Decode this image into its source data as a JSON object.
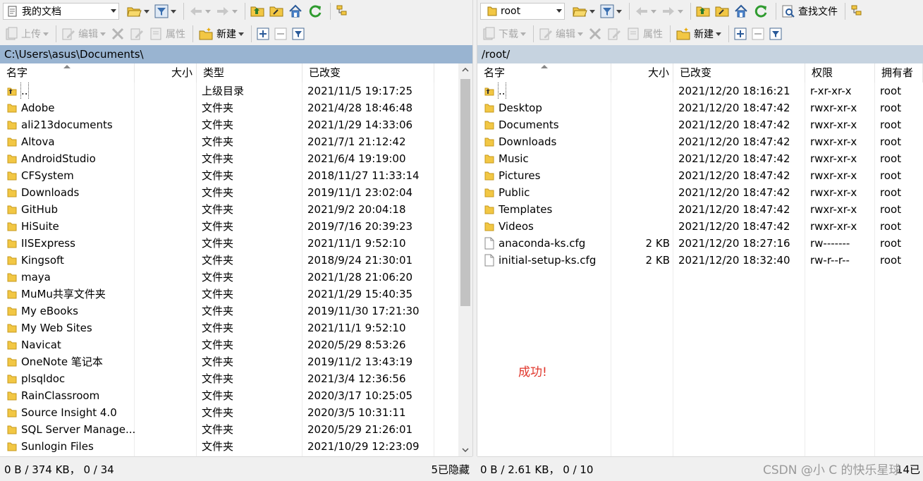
{
  "left": {
    "location": "我的文档",
    "path": "C:\\Users\\asus\\Documents\\",
    "toolbar2": {
      "upload": "上传",
      "edit": "编辑",
      "properties": "属性",
      "new": "新建"
    },
    "columns": {
      "name": "名字",
      "size": "大小",
      "type": "类型",
      "modified": "已改变"
    },
    "rows": [
      {
        "name": "..",
        "size": "",
        "type": "上级目录",
        "modified": "2021/11/5  19:17:25",
        "icon": "parent"
      },
      {
        "name": "Adobe",
        "size": "",
        "type": "文件夹",
        "modified": "2021/4/28  18:46:48",
        "icon": "folder"
      },
      {
        "name": "ali213documents",
        "size": "",
        "type": "文件夹",
        "modified": "2021/1/29  14:33:06",
        "icon": "folder"
      },
      {
        "name": "Altova",
        "size": "",
        "type": "文件夹",
        "modified": "2021/7/1  21:12:42",
        "icon": "folder"
      },
      {
        "name": "AndroidStudio",
        "size": "",
        "type": "文件夹",
        "modified": "2021/6/4  19:19:00",
        "icon": "folder"
      },
      {
        "name": "CFSystem",
        "size": "",
        "type": "文件夹",
        "modified": "2018/11/27  11:33:14",
        "icon": "folder"
      },
      {
        "name": "Downloads",
        "size": "",
        "type": "文件夹",
        "modified": "2019/11/1  23:02:04",
        "icon": "folder"
      },
      {
        "name": "GitHub",
        "size": "",
        "type": "文件夹",
        "modified": "2021/9/2  20:04:18",
        "icon": "folder"
      },
      {
        "name": "HiSuite",
        "size": "",
        "type": "文件夹",
        "modified": "2019/7/16  20:39:23",
        "icon": "folder"
      },
      {
        "name": "IISExpress",
        "size": "",
        "type": "文件夹",
        "modified": "2021/11/1  9:52:10",
        "icon": "folder"
      },
      {
        "name": "Kingsoft",
        "size": "",
        "type": "文件夹",
        "modified": "2018/9/24  21:30:01",
        "icon": "folder"
      },
      {
        "name": "maya",
        "size": "",
        "type": "文件夹",
        "modified": "2021/1/28  21:06:20",
        "icon": "folder"
      },
      {
        "name": "MuMu共享文件夹",
        "size": "",
        "type": "文件夹",
        "modified": "2021/1/29  15:40:35",
        "icon": "folder"
      },
      {
        "name": "My eBooks",
        "size": "",
        "type": "文件夹",
        "modified": "2019/11/30  17:21:30",
        "icon": "folder"
      },
      {
        "name": "My Web Sites",
        "size": "",
        "type": "文件夹",
        "modified": "2021/11/1  9:52:10",
        "icon": "folder"
      },
      {
        "name": "Navicat",
        "size": "",
        "type": "文件夹",
        "modified": "2020/5/29  8:53:26",
        "icon": "folder"
      },
      {
        "name": "OneNote 笔记本",
        "size": "",
        "type": "文件夹",
        "modified": "2019/11/2  13:43:19",
        "icon": "folder"
      },
      {
        "name": "plsqldoc",
        "size": "",
        "type": "文件夹",
        "modified": "2021/3/4  12:36:56",
        "icon": "folder"
      },
      {
        "name": "RainClassroom",
        "size": "",
        "type": "文件夹",
        "modified": "2020/3/17  10:25:05",
        "icon": "folder"
      },
      {
        "name": "Source Insight 4.0",
        "size": "",
        "type": "文件夹",
        "modified": "2020/3/5  10:31:11",
        "icon": "folder"
      },
      {
        "name": "SQL Server Manage...",
        "size": "",
        "type": "文件夹",
        "modified": "2020/5/29  21:26:01",
        "icon": "folder"
      },
      {
        "name": "Sunlogin Files",
        "size": "",
        "type": "文件夹",
        "modified": "2021/10/29  12:23:09",
        "icon": "folder"
      }
    ],
    "status": {
      "summary": "0 B / 374 KB，  0 / 34",
      "hidden": "5已隐藏"
    }
  },
  "right": {
    "location": "root",
    "find_files": "查找文件",
    "path": "/root/",
    "toolbar2": {
      "download": "下载",
      "edit": "编辑",
      "properties": "属性",
      "new": "新建"
    },
    "columns": {
      "name": "名字",
      "size": "大小",
      "modified": "已改变",
      "permissions": "权限",
      "owner": "拥有者"
    },
    "rows": [
      {
        "name": "..",
        "size": "",
        "modified": "2021/12/20 18:16:21",
        "permissions": "r-xr-xr-x",
        "owner": "root",
        "icon": "parent"
      },
      {
        "name": "Desktop",
        "size": "",
        "modified": "2021/12/20 18:47:42",
        "permissions": "rwxr-xr-x",
        "owner": "root",
        "icon": "folder"
      },
      {
        "name": "Documents",
        "size": "",
        "modified": "2021/12/20 18:47:42",
        "permissions": "rwxr-xr-x",
        "owner": "root",
        "icon": "folder"
      },
      {
        "name": "Downloads",
        "size": "",
        "modified": "2021/12/20 18:47:42",
        "permissions": "rwxr-xr-x",
        "owner": "root",
        "icon": "folder"
      },
      {
        "name": "Music",
        "size": "",
        "modified": "2021/12/20 18:47:42",
        "permissions": "rwxr-xr-x",
        "owner": "root",
        "icon": "folder"
      },
      {
        "name": "Pictures",
        "size": "",
        "modified": "2021/12/20 18:47:42",
        "permissions": "rwxr-xr-x",
        "owner": "root",
        "icon": "folder"
      },
      {
        "name": "Public",
        "size": "",
        "modified": "2021/12/20 18:47:42",
        "permissions": "rwxr-xr-x",
        "owner": "root",
        "icon": "folder"
      },
      {
        "name": "Templates",
        "size": "",
        "modified": "2021/12/20 18:47:42",
        "permissions": "rwxr-xr-x",
        "owner": "root",
        "icon": "folder"
      },
      {
        "name": "Videos",
        "size": "",
        "modified": "2021/12/20 18:47:42",
        "permissions": "rwxr-xr-x",
        "owner": "root",
        "icon": "folder"
      },
      {
        "name": "anaconda-ks.cfg",
        "size": "2 KB",
        "modified": "2021/12/20 18:27:16",
        "permissions": "rw-------",
        "owner": "root",
        "icon": "file"
      },
      {
        "name": "initial-setup-ks.cfg",
        "size": "2 KB",
        "modified": "2021/12/20 18:32:40",
        "permissions": "rw-r--r--",
        "owner": "root",
        "icon": "file"
      }
    ],
    "status": {
      "summary": "0 B / 2.61 KB，  0 / 10",
      "hidden": "14已"
    }
  },
  "annotation": "成功!",
  "watermark": "CSDN @小 C 的快乐星球"
}
